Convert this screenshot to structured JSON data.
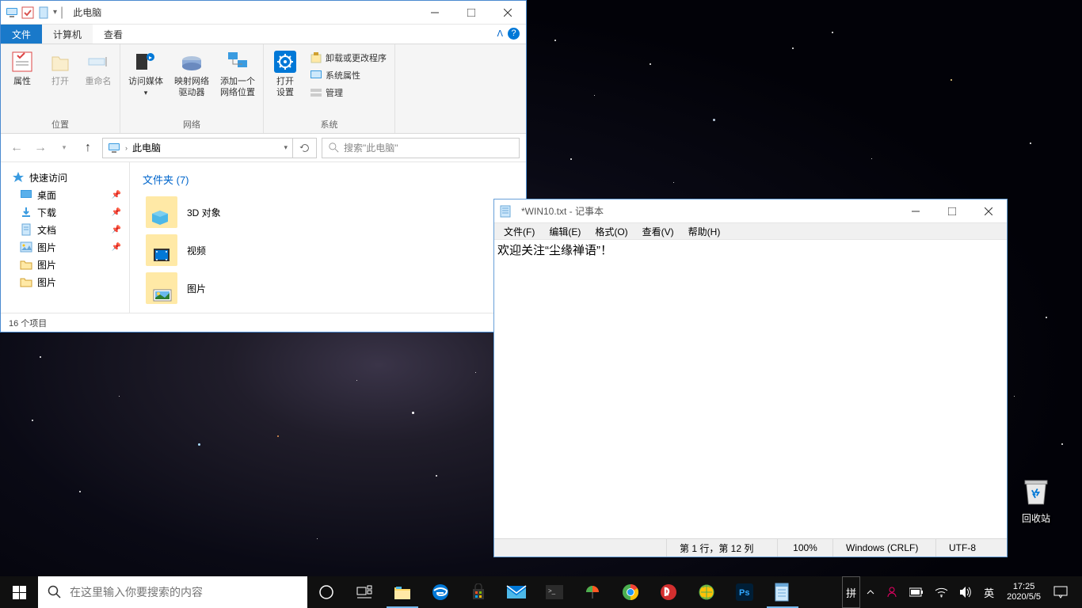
{
  "desktop": {
    "recycle_bin": "回收站"
  },
  "explorer": {
    "title": "此电脑",
    "tabs": {
      "file": "文件",
      "computer": "计算机",
      "view": "查看"
    },
    "ribbon": {
      "location": {
        "label": "位置",
        "properties": "属性",
        "open": "打开",
        "rename": "重命名"
      },
      "network": {
        "label": "网络",
        "access_media": "访问媒体",
        "map_drive": "映射网络\n驱动器",
        "add_location": "添加一个\n网络位置"
      },
      "system": {
        "label": "系统",
        "open_settings": "打开\n设置",
        "uninstall": "卸载或更改程序",
        "sys_props": "系统属性",
        "manage": "管理"
      }
    },
    "address": "此电脑",
    "search_placeholder": "搜索\"此电脑\"",
    "nav": {
      "quick": "快速访问",
      "desktop": "桌面",
      "downloads": "下载",
      "documents": "文档",
      "pictures": "图片",
      "pictures2": "图片",
      "pictures3": "图片"
    },
    "section_folders": "文件夹 (7)",
    "tiles": {
      "3d": "3D 对象",
      "video": "视频",
      "pictures": "图片"
    },
    "status": "16 个项目"
  },
  "notepad": {
    "title": "*WIN10.txt - 记事本",
    "menu": {
      "file": "文件(F)",
      "edit": "编辑(E)",
      "format": "格式(O)",
      "view": "查看(V)",
      "help": "帮助(H)"
    },
    "content": "欢迎关注“尘缘禅语”！",
    "status": {
      "pos": "第 1 行，第 12 列",
      "zoom": "100%",
      "eol": "Windows (CRLF)",
      "enc": "UTF-8"
    }
  },
  "taskbar": {
    "search_placeholder": "在这里输入你要搜索的内容",
    "ime_pin": "拼",
    "ime_lang": "英",
    "time": "17:25",
    "date": "2020/5/5"
  }
}
